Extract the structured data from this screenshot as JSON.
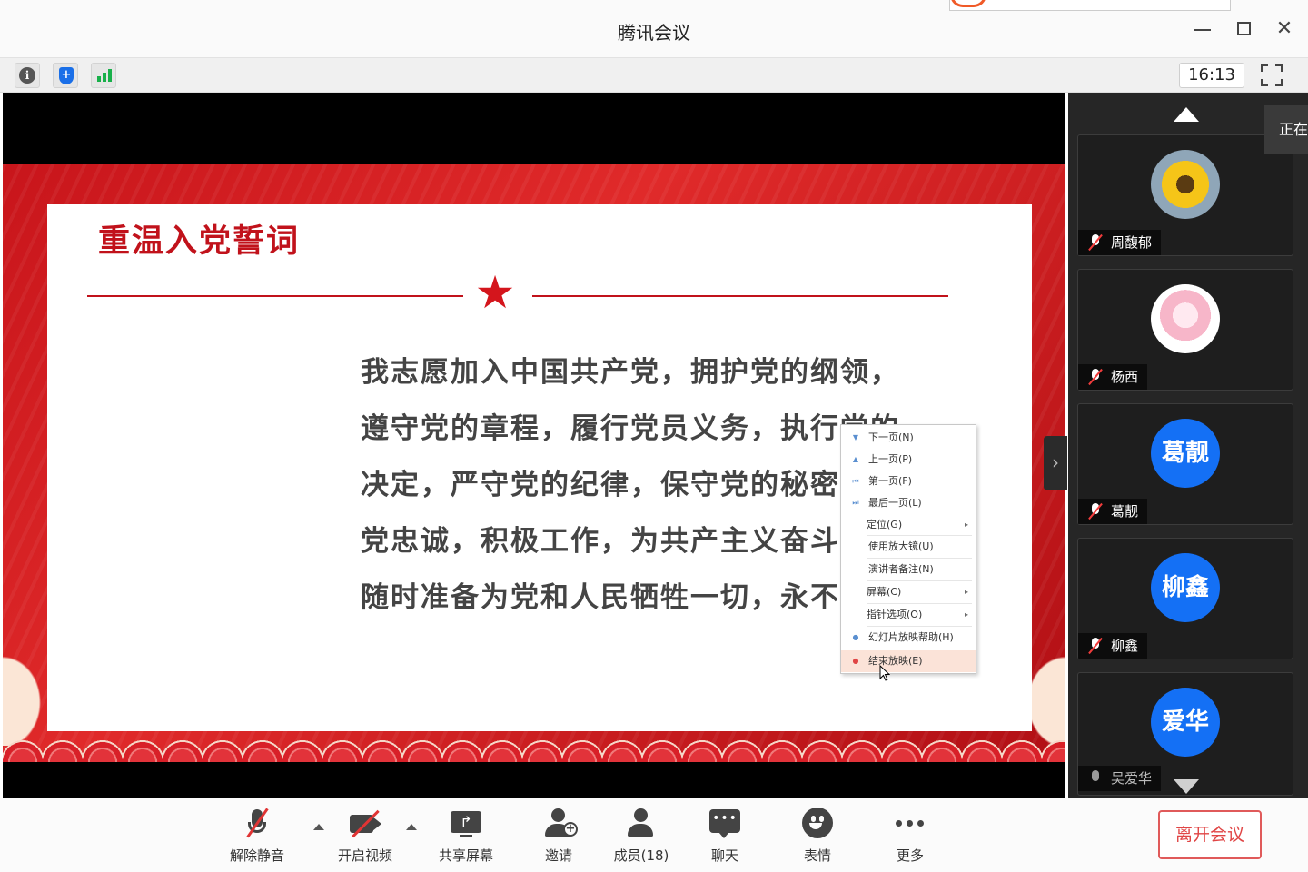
{
  "window": {
    "title": "腾讯会议",
    "clock": "16:13"
  },
  "icons": {
    "info": "info-icon",
    "shield": "shield-icon",
    "signal": "signal-icon",
    "fullscreen": "fullscreen-icon"
  },
  "slide": {
    "title": "重温入党誓词",
    "oath_lines": [
      "我志愿加入中国共产党，拥护党的纲领，",
      "遵守党的章程，履行党员义务，执行党的",
      "决定，严守党的纪律，保守党的秘密，对",
      "党忠诚，积极工作，为共产主义奋斗终身，",
      "随时准备为党和人民牺牲一切，永不叛党。"
    ],
    "colors": {
      "accent": "#c1121b",
      "background": "#d4151c"
    }
  },
  "context_menu": {
    "items": [
      "下一页(N)",
      "上一页(P)",
      "第一页(F)",
      "最后一页(L)",
      "定位(G)",
      "使用放大镜(U)",
      "演讲者备注(N)",
      "屏幕(C)",
      "指针选项(O)",
      "幻灯片放映帮助(H)",
      "结束放映(E)"
    ]
  },
  "participants": [
    {
      "name": "周馥郁",
      "avatar": "sunflower-photo",
      "muted": true
    },
    {
      "name": "杨西",
      "avatar": "anime-girl-photo",
      "muted": true
    },
    {
      "name": "葛靓",
      "avatar_text": "葛靓",
      "muted": true
    },
    {
      "name": "柳鑫",
      "avatar_text": "柳鑫",
      "muted": true
    },
    {
      "name": "吴爱华",
      "avatar_text": "爱华",
      "muted": false
    }
  ],
  "speaking_tab": "正在",
  "toolbar": {
    "unmute": "解除静音",
    "start_video": "开启视频",
    "share_screen": "共享屏幕",
    "invite": "邀请",
    "members": "成员(18)",
    "chat": "聊天",
    "emoji": "表情",
    "more": "更多",
    "leave": "离开会议"
  }
}
